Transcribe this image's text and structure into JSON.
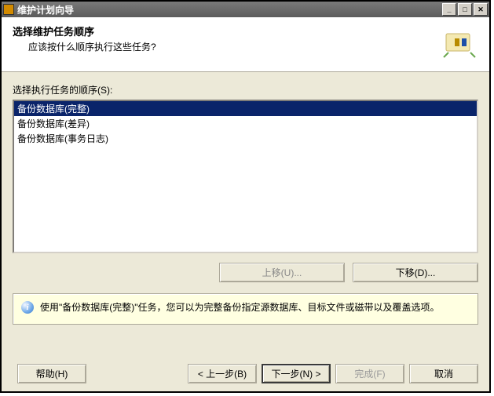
{
  "window": {
    "title": "维护计划向导"
  },
  "header": {
    "title": "选择维护任务顺序",
    "subtitle": "应该按什么顺序执行这些任务?"
  },
  "listbox": {
    "label": "选择执行任务的顺序(S):",
    "items": [
      {
        "text": "备份数据库(完整)",
        "selected": true
      },
      {
        "text": "备份数据库(差异)",
        "selected": false
      },
      {
        "text": "备份数据库(事务日志)",
        "selected": false
      }
    ]
  },
  "move_buttons": {
    "up": "上移(U)...",
    "down": "下移(D)..."
  },
  "info": {
    "text": "使用\"备份数据库(完整)\"任务，您可以为完整备份指定源数据库、目标文件或磁带以及覆盖选项。"
  },
  "footer": {
    "help": "帮助(H)",
    "back": "< 上一步(B)",
    "next": "下一步(N) >",
    "finish": "完成(F)",
    "cancel": "取消"
  }
}
